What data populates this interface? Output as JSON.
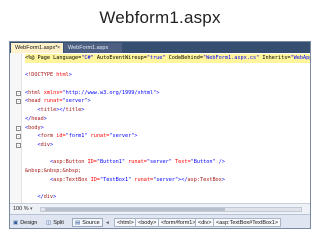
{
  "slide": {
    "title": "Webform1.aspx"
  },
  "ide": {
    "tabs": [
      {
        "label": "WebForm1.aspx*",
        "close": "×"
      },
      {
        "label": "WebForm1.aspx",
        "close": ""
      }
    ],
    "code_lines": [
      {
        "fold": "",
        "highlight": true,
        "segments": [
          {
            "t": "<%@ Page Language=",
            "c": "plain"
          },
          {
            "t": "\"C#\"",
            "c": "val"
          },
          {
            "t": " AutoEventWireup=",
            "c": "plain"
          },
          {
            "t": "\"true\"",
            "c": "val"
          },
          {
            "t": " CodeBehind=",
            "c": "plain"
          },
          {
            "t": "\"WebForm1.aspx.cs\"",
            "c": "val"
          },
          {
            "t": " Inherits=",
            "c": "plain"
          },
          {
            "t": "\"WebApplication1.W",
            "c": "val"
          }
        ]
      },
      {
        "fold": "",
        "highlight": false,
        "segments": []
      },
      {
        "fold": "",
        "highlight": false,
        "segments": [
          {
            "t": "<",
            "c": "blue"
          },
          {
            "t": "!DOCTYPE",
            "c": "tag"
          },
          {
            "t": " html",
            "c": "attr"
          },
          {
            "t": ">",
            "c": "blue"
          }
        ]
      },
      {
        "fold": "",
        "highlight": false,
        "segments": []
      },
      {
        "fold": "-",
        "highlight": false,
        "segments": [
          {
            "t": "<",
            "c": "blue"
          },
          {
            "t": "html",
            "c": "tag"
          },
          {
            "t": " xmlns=",
            "c": "attr"
          },
          {
            "t": "\"http://www.w3.org/1999/xhtml\"",
            "c": "val"
          },
          {
            "t": ">",
            "c": "blue"
          }
        ]
      },
      {
        "fold": "-",
        "highlight": false,
        "segments": [
          {
            "t": "<",
            "c": "blue"
          },
          {
            "t": "head",
            "c": "tag"
          },
          {
            "t": " runat=",
            "c": "attr"
          },
          {
            "t": "\"server\"",
            "c": "val"
          },
          {
            "t": ">",
            "c": "blue"
          }
        ]
      },
      {
        "fold": "",
        "highlight": false,
        "segments": [
          {
            "t": "    <",
            "c": "blue"
          },
          {
            "t": "title",
            "c": "tag"
          },
          {
            "t": "></",
            "c": "blue"
          },
          {
            "t": "title",
            "c": "tag"
          },
          {
            "t": ">",
            "c": "blue"
          }
        ]
      },
      {
        "fold": "",
        "highlight": false,
        "segments": [
          {
            "t": "</",
            "c": "blue"
          },
          {
            "t": "head",
            "c": "tag"
          },
          {
            "t": ">",
            "c": "blue"
          }
        ]
      },
      {
        "fold": "-",
        "highlight": false,
        "segments": [
          {
            "t": "<",
            "c": "blue"
          },
          {
            "t": "body",
            "c": "tag"
          },
          {
            "t": ">",
            "c": "blue"
          }
        ]
      },
      {
        "fold": "-",
        "highlight": false,
        "segments": [
          {
            "t": "    <",
            "c": "blue"
          },
          {
            "t": "form",
            "c": "tag"
          },
          {
            "t": " id=",
            "c": "attr"
          },
          {
            "t": "\"form1\"",
            "c": "val"
          },
          {
            "t": " runat=",
            "c": "attr"
          },
          {
            "t": "\"server\"",
            "c": "val"
          },
          {
            "t": ">",
            "c": "blue"
          }
        ]
      },
      {
        "fold": "-",
        "highlight": false,
        "segments": [
          {
            "t": "    <",
            "c": "blue"
          },
          {
            "t": "div",
            "c": "tag"
          },
          {
            "t": ">",
            "c": "blue"
          }
        ]
      },
      {
        "fold": "",
        "highlight": false,
        "segments": []
      },
      {
        "fold": "",
        "highlight": false,
        "segments": [
          {
            "t": "        <",
            "c": "blue"
          },
          {
            "t": "asp:Button",
            "c": "tag"
          },
          {
            "t": " ID=",
            "c": "attr"
          },
          {
            "t": "\"Button1\"",
            "c": "val"
          },
          {
            "t": " runat=",
            "c": "attr"
          },
          {
            "t": "\"server\"",
            "c": "val"
          },
          {
            "t": " Text=",
            "c": "attr"
          },
          {
            "t": "\"Button\"",
            "c": "val"
          },
          {
            "t": " />",
            "c": "blue"
          }
        ]
      },
      {
        "fold": "",
        "highlight": false,
        "segments": [
          {
            "t": "&nbsp;&nbsp;&nbsp;",
            "c": "tag"
          }
        ]
      },
      {
        "fold": "",
        "highlight": false,
        "segments": [
          {
            "t": "        <",
            "c": "blue"
          },
          {
            "t": "asp:TextBox",
            "c": "tag"
          },
          {
            "t": " ID=",
            "c": "attr"
          },
          {
            "t": "\"TextBox1\"",
            "c": "val"
          },
          {
            "t": " runat=",
            "c": "attr"
          },
          {
            "t": "\"server\"",
            "c": "val"
          },
          {
            "t": "></",
            "c": "blue"
          },
          {
            "t": "asp:TextBox",
            "c": "tag"
          },
          {
            "t": ">",
            "c": "blue"
          }
        ]
      },
      {
        "fold": "",
        "highlight": false,
        "segments": []
      },
      {
        "fold": "",
        "highlight": false,
        "segments": [
          {
            "t": "    </",
            "c": "blue"
          },
          {
            "t": "div",
            "c": "tag"
          },
          {
            "t": ">",
            "c": "blue"
          }
        ]
      },
      {
        "fold": "",
        "highlight": false,
        "segments": [
          {
            "t": "    </",
            "c": "blue"
          },
          {
            "t": "form",
            "c": "tag"
          },
          {
            "t": ">",
            "c": "blue"
          }
        ]
      },
      {
        "fold": "",
        "highlight": false,
        "segments": [
          {
            "t": "</",
            "c": "blue"
          },
          {
            "t": "body",
            "c": "tag"
          },
          {
            "t": ">",
            "c": "blue"
          }
        ]
      },
      {
        "fold": "",
        "highlight": false,
        "segments": [
          {
            "t": "</",
            "c": "blue"
          },
          {
            "t": "html",
            "c": "tag"
          },
          {
            "t": ">",
            "c": "blue"
          }
        ]
      }
    ],
    "status": {
      "zoom": "100 %",
      "zoom_arrow": "▾"
    },
    "view_bar": {
      "design": "Design",
      "split": "Split",
      "source": "Source",
      "crumbs": [
        "<html>",
        "<body>",
        "<form#form1>",
        "<div>",
        "<asp:TextBox#TextBox1>"
      ]
    },
    "colors": {
      "tab_strip": "#364e6f",
      "active_tab": "#fff1c9",
      "tag": "#a31515",
      "attribute": "#ff0000",
      "value": "#0000ff",
      "highlight": "#fff59d"
    }
  }
}
